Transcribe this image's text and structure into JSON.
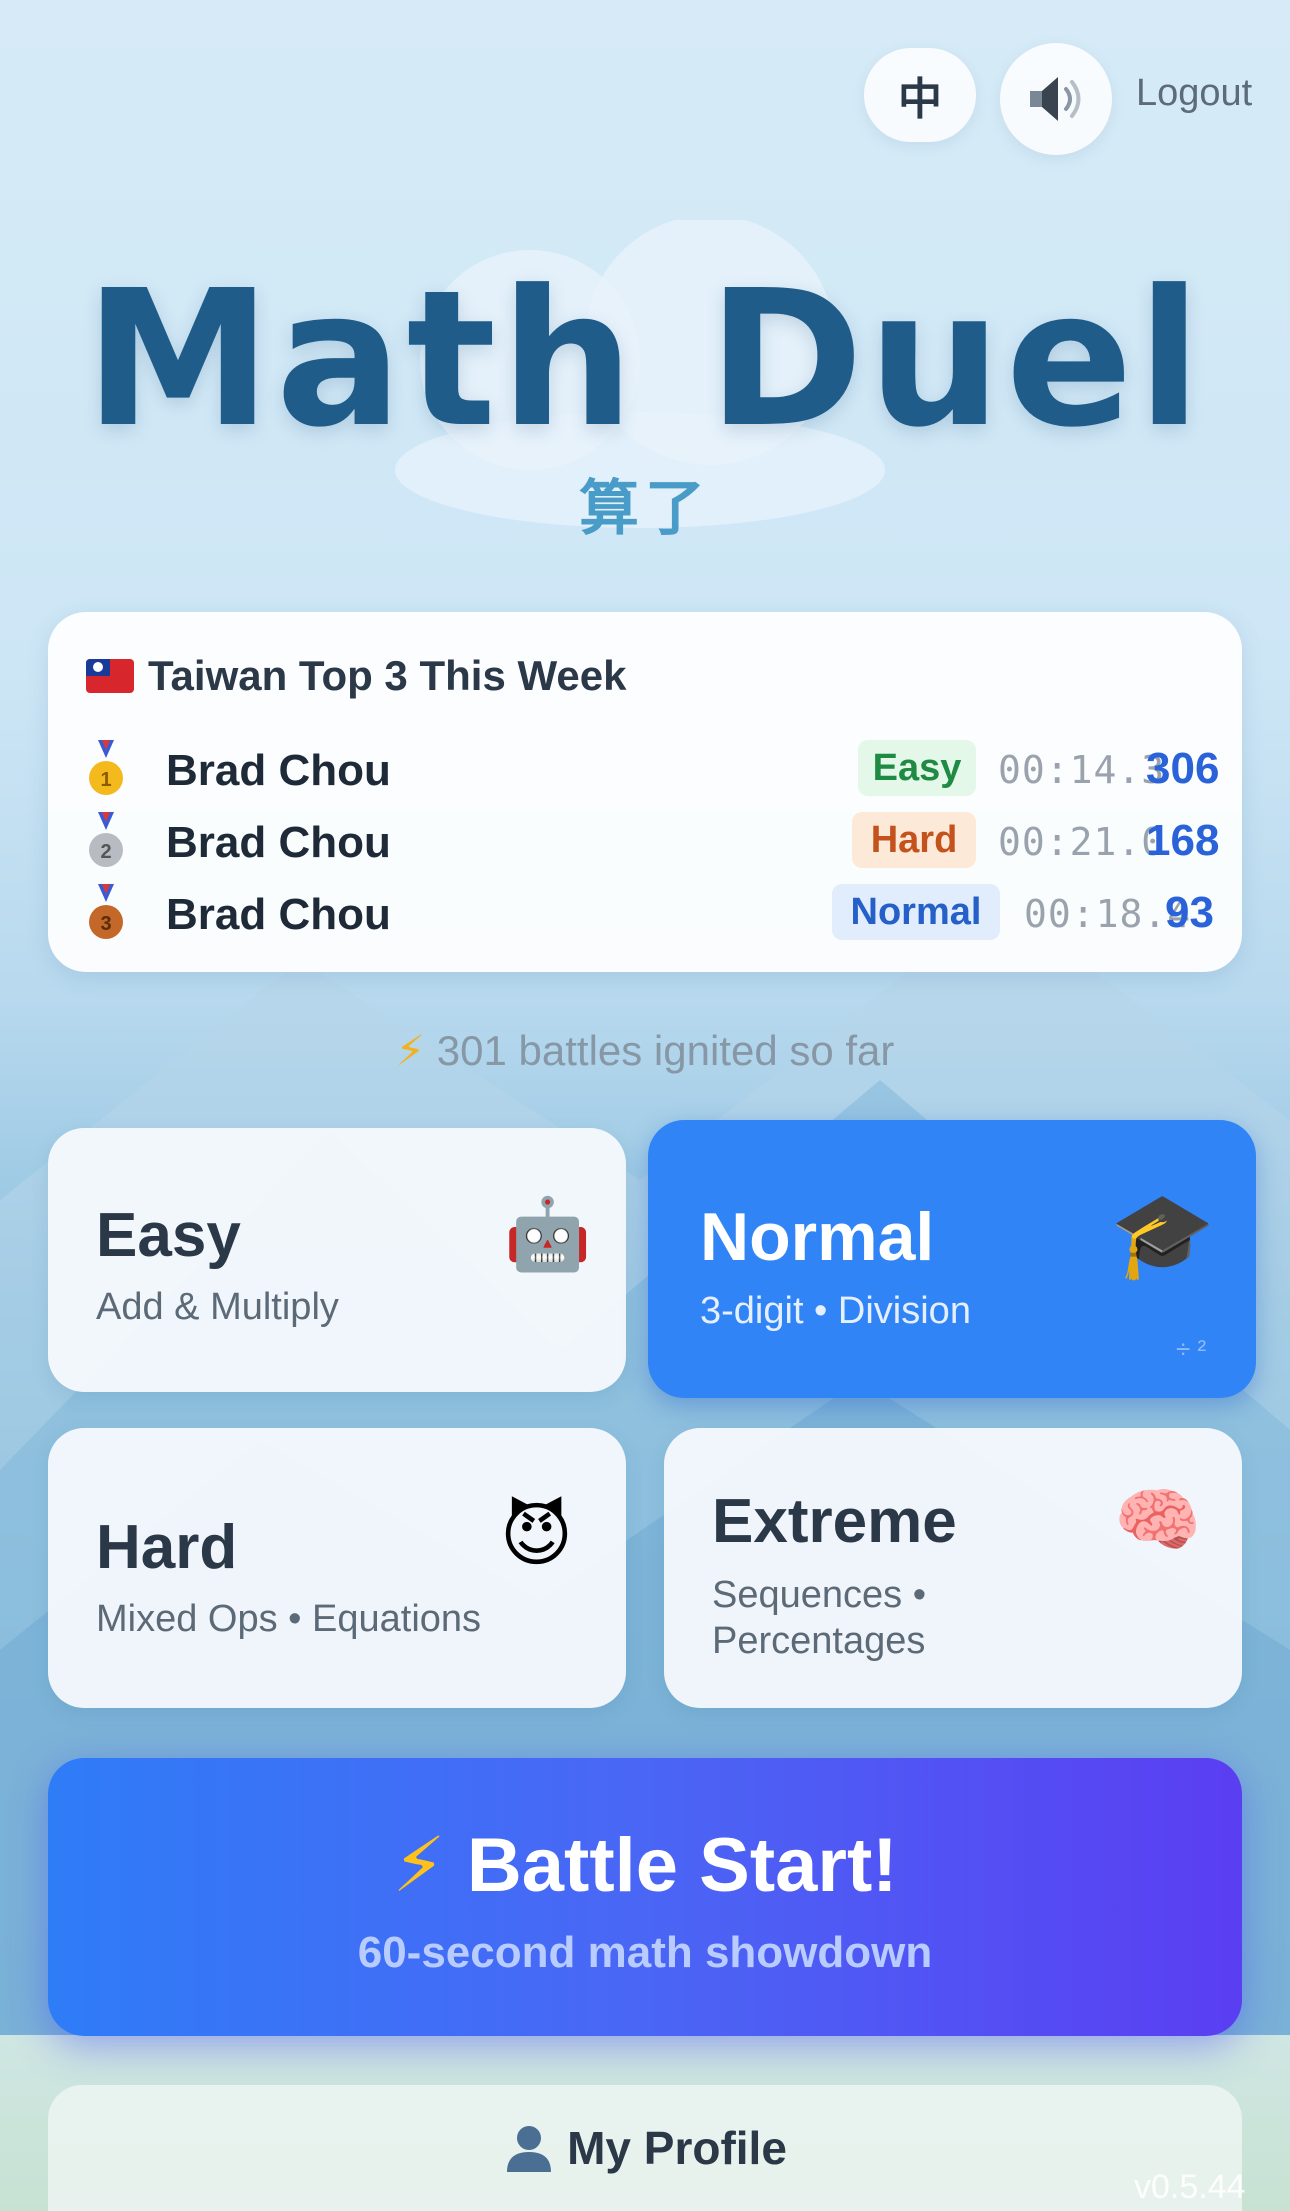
{
  "topbar": {
    "language_label": "中",
    "logout_label": "Logout"
  },
  "header": {
    "title": "Math Duel",
    "subtitle": "算了"
  },
  "leaderboard": {
    "title": "Taiwan Top 3 This Week",
    "rows": [
      {
        "name": "Brad Chou",
        "difficulty": "Easy",
        "time": "00:14.3",
        "score": "306",
        "medal": "gold"
      },
      {
        "name": "Brad Chou",
        "difficulty": "Hard",
        "time": "00:21.0",
        "score": "168",
        "medal": "silver"
      },
      {
        "name": "Brad Chou",
        "difficulty": "Normal",
        "time": "00:18.4",
        "score": "93",
        "medal": "bronze"
      }
    ]
  },
  "battles": {
    "text": "301 battles ignited so far"
  },
  "modes": [
    {
      "title": "Easy",
      "sub": "Add & Multiply",
      "emoji": "🤖",
      "selected": false
    },
    {
      "title": "Normal",
      "sub": "3-digit • Division",
      "emoji": "🎓",
      "selected": true,
      "corner": "÷ ²"
    },
    {
      "title": "Hard",
      "sub": "Mixed Ops • Equations",
      "emoji": "😈",
      "selected": false
    },
    {
      "title": "Extreme",
      "sub_line1": "Sequences •",
      "sub_line2": "Percentages",
      "emoji": "🧠",
      "selected": false
    }
  ],
  "cta": {
    "title": "Battle Start!",
    "subtitle": "60-second math showdown"
  },
  "profile": {
    "label": "My Profile"
  },
  "version": "v0.5.44",
  "colors": {
    "primary": "#3184f6",
    "title": "#1f5c8a",
    "score": "#2a62d9",
    "easy_badge_bg": "#e3f8e8",
    "easy_badge_fg": "#1e8a43",
    "hard_badge_bg": "#fde9d8",
    "hard_badge_fg": "#c4521c",
    "normal_badge_bg": "#e1ecfd",
    "normal_badge_fg": "#2460c8"
  }
}
